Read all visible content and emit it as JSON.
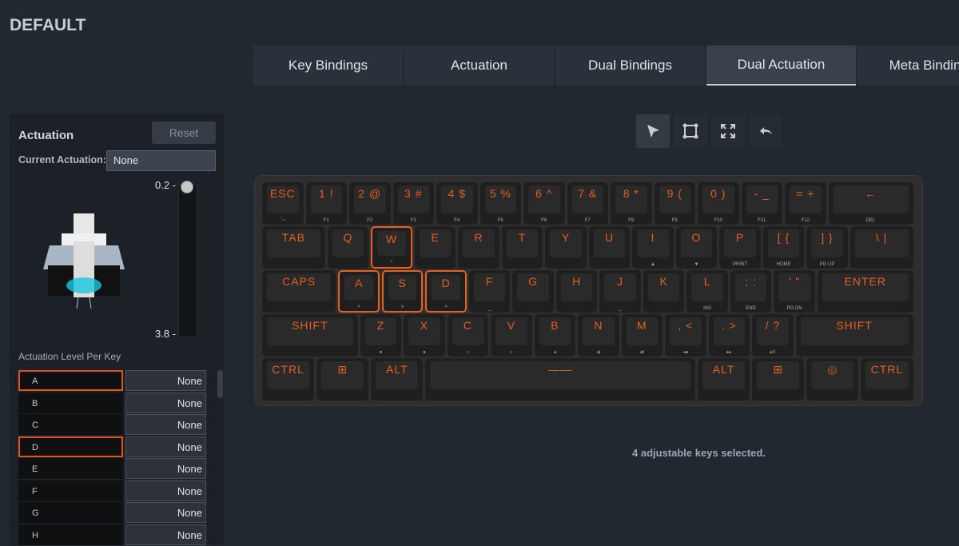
{
  "profile_title": "DEFAULT",
  "tabs": [
    {
      "label": "Key Bindings"
    },
    {
      "label": "Actuation"
    },
    {
      "label": "Dual Bindings"
    },
    {
      "label": "Dual Actuation",
      "active": true
    },
    {
      "label": "Meta Bindings"
    }
  ],
  "panel": {
    "heading": "Actuation",
    "reset_label": "Reset",
    "current_label": "Current Actuation:",
    "current_value": "None",
    "slider": {
      "min_label": "0.2 -",
      "max_label": "3.8 -",
      "value": 0.2
    },
    "per_key_label": "Actuation Level Per Key",
    "keys": [
      {
        "name": "A",
        "value": "None",
        "selected": true
      },
      {
        "name": "B",
        "value": "None"
      },
      {
        "name": "C",
        "value": "None"
      },
      {
        "name": "D",
        "value": "None",
        "selected": true
      },
      {
        "name": "E",
        "value": "None"
      },
      {
        "name": "F",
        "value": "None"
      },
      {
        "name": "G",
        "value": "None"
      },
      {
        "name": "H",
        "value": "None"
      }
    ]
  },
  "toolbar": [
    "select-arrow-icon",
    "marquee-select-icon",
    "expand-icon",
    "undo-icon"
  ],
  "accent": "#e6601f",
  "keyboard": [
    [
      [
        "ESC",
        "`~"
      ],
      [
        "1 !",
        "F1"
      ],
      [
        "2 @",
        "F2"
      ],
      [
        "3 #",
        "F3"
      ],
      [
        "4 $",
        "F4"
      ],
      [
        "5 %",
        "F5"
      ],
      [
        "6 ^",
        "F6"
      ],
      [
        "7 &",
        "F7"
      ],
      [
        "8 *",
        "F8"
      ],
      [
        "9 (",
        "F9"
      ],
      [
        "0 )",
        "F10"
      ],
      [
        "- _",
        "F11"
      ],
      [
        "= +",
        "F12"
      ],
      [
        "←",
        "DEL"
      ]
    ],
    [
      [
        "TAB",
        ""
      ],
      [
        "Q",
        ""
      ],
      [
        "W",
        "^"
      ],
      [
        "E",
        ""
      ],
      [
        "R",
        ""
      ],
      [
        "T",
        ""
      ],
      [
        "Y",
        ""
      ],
      [
        "U",
        ""
      ],
      [
        "I",
        "▲"
      ],
      [
        "O",
        "▼"
      ],
      [
        "P",
        "PRINT"
      ],
      [
        "[ {",
        "HOME"
      ],
      [
        "] }",
        "PG UP"
      ],
      [
        "\\ |",
        ""
      ]
    ],
    [
      [
        "CAPS",
        ""
      ],
      [
        "A",
        "<"
      ],
      [
        "S",
        "v"
      ],
      [
        "D",
        ">"
      ],
      [
        "F",
        "_"
      ],
      [
        "G",
        ""
      ],
      [
        "H",
        ""
      ],
      [
        "J",
        "_"
      ],
      [
        "K",
        ""
      ],
      [
        "L",
        "INS"
      ],
      [
        "; :",
        "END"
      ],
      [
        "' \"",
        "PG DN"
      ],
      [
        "ENTER",
        ""
      ]
    ],
    [
      [
        "SHIFT",
        ""
      ],
      [
        "Z",
        "●"
      ],
      [
        "X",
        "●"
      ],
      [
        "C",
        "☼"
      ],
      [
        "V",
        "☼"
      ],
      [
        "B",
        "◂"
      ],
      [
        "N",
        "◂)"
      ],
      [
        "M",
        "◂x"
      ],
      [
        ", <",
        "◂◂"
      ],
      [
        ". >",
        "▸▸"
      ],
      [
        "/ ?",
        "▸II"
      ],
      [
        "SHIFT",
        ""
      ]
    ],
    [
      [
        "CTRL",
        ""
      ],
      [
        "⊞",
        ""
      ],
      [
        "ALT",
        ""
      ],
      [
        "——",
        ""
      ],
      [
        "ALT",
        ""
      ],
      [
        "⊞",
        ""
      ],
      [
        "◎",
        ""
      ],
      [
        "CTRL",
        ""
      ]
    ]
  ],
  "selected_keys": [
    "W",
    "A",
    "S",
    "D"
  ],
  "status": "4 adjustable keys selected."
}
